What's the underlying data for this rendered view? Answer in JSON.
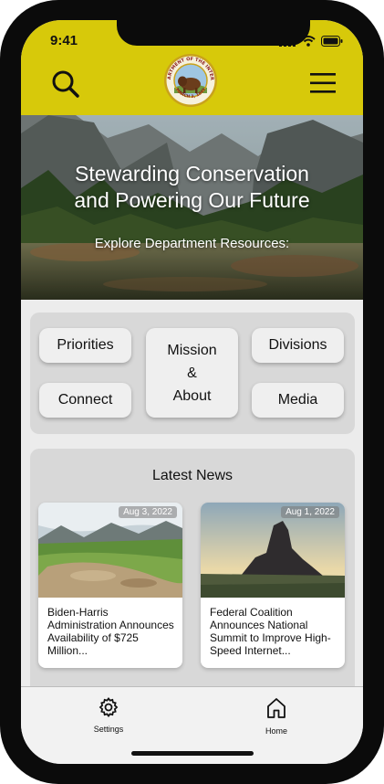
{
  "status_bar": {
    "time": "9:41",
    "icons": [
      "signal-icon",
      "wifi-icon",
      "battery-icon"
    ]
  },
  "header": {
    "logo": "department-seal",
    "logo_text": [
      "DEPARTMENT OF THE INTERIOR",
      "MARCH 3, 1849"
    ],
    "search_icon": "search-icon",
    "menu_icon": "hamburger-menu-icon",
    "background_color": "#d7c90a"
  },
  "hero": {
    "title_line1": "Stewarding Conservation",
    "title_line2": "and Powering Our Future",
    "subtitle": "Explore Department Resources:"
  },
  "categories": {
    "priorities": "Priorities",
    "connect": "Connect",
    "mission_line1": "Mission",
    "mission_line2": "&",
    "mission_line3": "About",
    "divisions": "Divisions",
    "media": "Media"
  },
  "news": {
    "title": "Latest News",
    "items": [
      {
        "date": "Aug 3, 2022",
        "headline": "Biden-Harris Administration Announces Availability of $725 Million..."
      },
      {
        "date": "Aug 1, 2022",
        "headline": "Federal Coalition Announces National Summit to Improve High-Speed Internet..."
      }
    ]
  },
  "bottom_nav": {
    "settings_label": "Settings",
    "home_label": "Home"
  }
}
